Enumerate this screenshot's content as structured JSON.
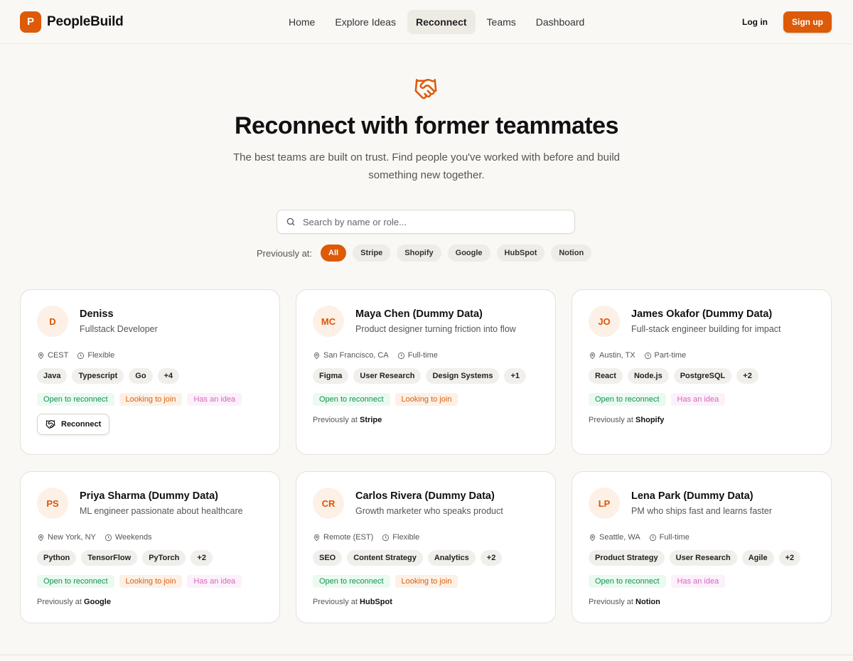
{
  "brand": {
    "logo_letter": "P",
    "name": "PeopleBuild",
    "accent": "#dd5a08"
  },
  "nav": {
    "items": [
      {
        "label": "Home",
        "active": false
      },
      {
        "label": "Explore Ideas",
        "active": false
      },
      {
        "label": "Reconnect",
        "active": true
      },
      {
        "label": "Teams",
        "active": false
      },
      {
        "label": "Dashboard",
        "active": false
      }
    ]
  },
  "auth": {
    "login_label": "Log in",
    "signup_label": "Sign up"
  },
  "hero": {
    "icon": "handshake-icon",
    "title": "Reconnect with former teammates",
    "subtitle": "The best teams are built on trust. Find people you've worked with before and build something new together."
  },
  "search": {
    "placeholder": "Search by name or role...",
    "value": ""
  },
  "filters": {
    "label": "Previously at:",
    "options": [
      {
        "label": "All",
        "active": true
      },
      {
        "label": "Stripe",
        "active": false
      },
      {
        "label": "Shopify",
        "active": false
      },
      {
        "label": "Google",
        "active": false
      },
      {
        "label": "HubSpot",
        "active": false
      },
      {
        "label": "Notion",
        "active": false
      }
    ]
  },
  "cards": [
    {
      "initials": "D",
      "name": "Deniss",
      "role": "Fullstack Developer",
      "location": "CEST",
      "availability": "Flexible",
      "skills": [
        "Java",
        "Typescript",
        "Go",
        "+4"
      ],
      "tags": {
        "open": "Open to reconnect",
        "join": "Looking to join",
        "idea": "Has an idea"
      },
      "reconnect_label": "Reconnect"
    },
    {
      "initials": "MC",
      "name": "Maya Chen (Dummy Data)",
      "role": "Product designer turning friction into flow",
      "location": "San Francisco, CA",
      "availability": "Full-time",
      "skills": [
        "Figma",
        "User Research",
        "Design Systems",
        "+1"
      ],
      "tags": {
        "open": "Open to reconnect",
        "join": "Looking to join"
      },
      "previously_label": "Previously at",
      "company": "Stripe"
    },
    {
      "initials": "JO",
      "name": "James Okafor (Dummy Data)",
      "role": "Full-stack engineer building for impact",
      "location": "Austin, TX",
      "availability": "Part-time",
      "skills": [
        "React",
        "Node.js",
        "PostgreSQL",
        "+2"
      ],
      "tags": {
        "open": "Open to reconnect",
        "idea": "Has an idea"
      },
      "previously_label": "Previously at",
      "company": "Shopify"
    },
    {
      "initials": "PS",
      "name": "Priya Sharma (Dummy Data)",
      "role": "ML engineer passionate about healthcare",
      "location": "New York, NY",
      "availability": "Weekends",
      "skills": [
        "Python",
        "TensorFlow",
        "PyTorch",
        "+2"
      ],
      "tags": {
        "open": "Open to reconnect",
        "join": "Looking to join",
        "idea": "Has an idea"
      },
      "previously_label": "Previously at",
      "company": "Google"
    },
    {
      "initials": "CR",
      "name": "Carlos Rivera (Dummy Data)",
      "role": "Growth marketer who speaks product",
      "location": "Remote (EST)",
      "availability": "Flexible",
      "skills": [
        "SEO",
        "Content Strategy",
        "Analytics",
        "+2"
      ],
      "tags": {
        "open": "Open to reconnect",
        "join": "Looking to join"
      },
      "previously_label": "Previously at",
      "company": "HubSpot"
    },
    {
      "initials": "LP",
      "name": "Lena Park (Dummy Data)",
      "role": "PM who ships fast and learns faster",
      "location": "Seattle, WA",
      "availability": "Full-time",
      "skills": [
        "Product Strategy",
        "User Research",
        "Agile",
        "+2"
      ],
      "tags": {
        "open": "Open to reconnect",
        "idea": "Has an idea"
      },
      "previously_label": "Previously at",
      "company": "Notion"
    }
  ]
}
